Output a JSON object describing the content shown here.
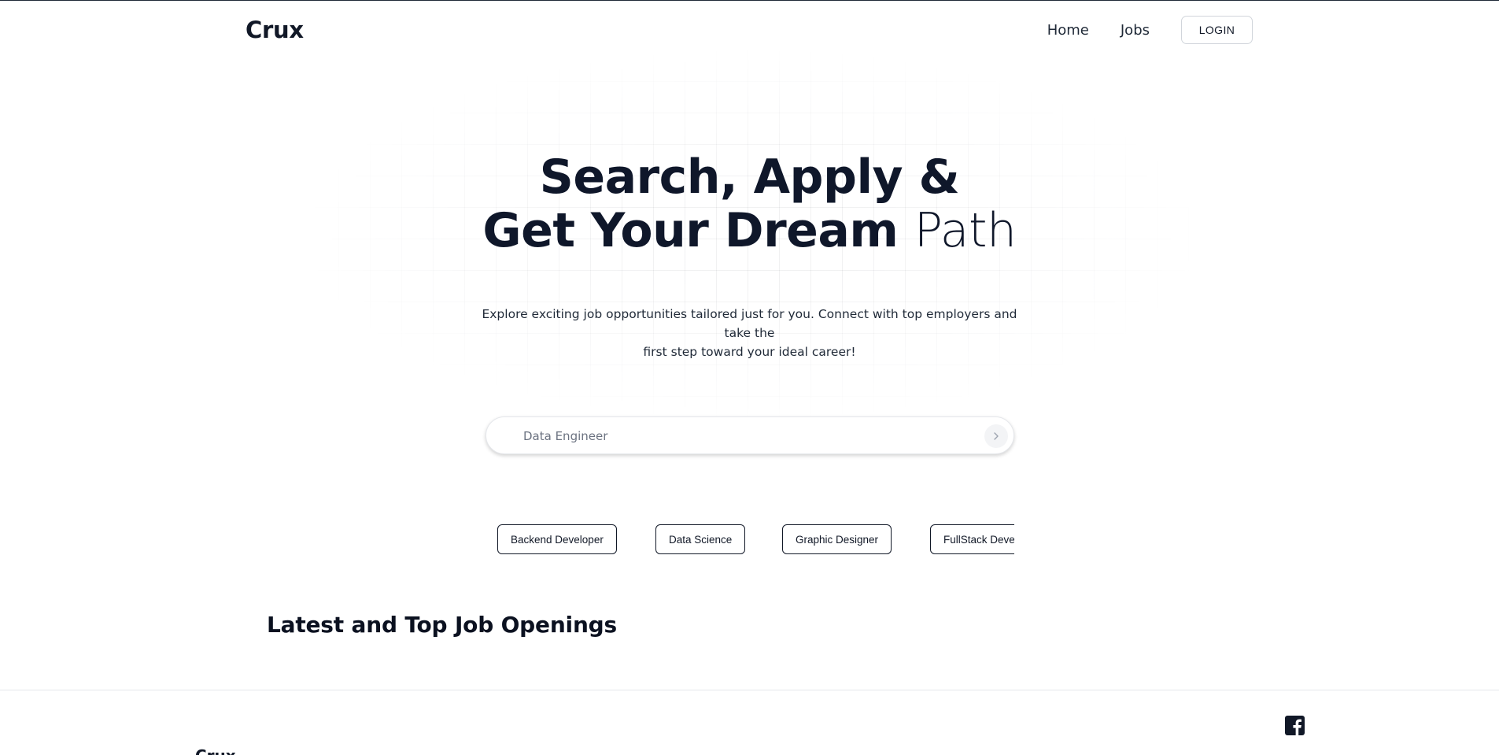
{
  "header": {
    "logo": "Crux",
    "nav": {
      "home": "Home",
      "jobs": "Jobs"
    },
    "login_label": "LOGIN"
  },
  "hero": {
    "title_line1": "Search, Apply &",
    "title_line2_strong": "Get Your Dream",
    "title_line2_light": "Path",
    "subtitle_line1": "Explore exciting job opportunities tailored just for you. Connect with top employers and take the",
    "subtitle_line2": "first step toward your ideal career!"
  },
  "search": {
    "placeholder": "Data Engineer",
    "value": "",
    "button_icon": "chevron-right-icon"
  },
  "categories": [
    "Backend Developer",
    "Data Science",
    "Graphic Designer",
    "FullStack Developer"
  ],
  "section": {
    "title": "Latest and Top Job Openings"
  },
  "footer": {
    "logo": "Crux",
    "social_icon": "facebook-icon"
  },
  "colors": {
    "text_primary": "#0f172a",
    "border": "#e5e7eb",
    "chip_border": "#111827"
  }
}
